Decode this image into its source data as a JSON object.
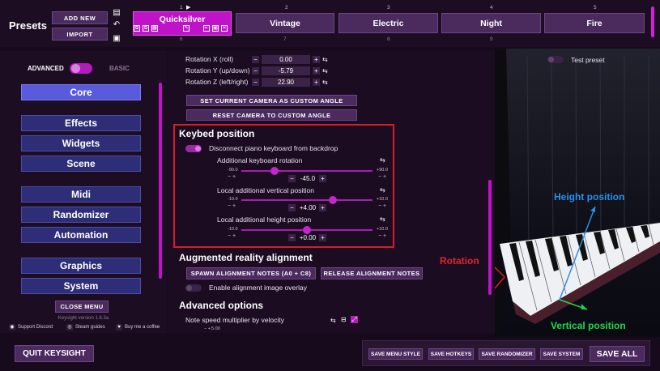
{
  "presets": {
    "label": "Presets",
    "add_new": "ADD NEW",
    "import": "IMPORT",
    "slots_row1": [
      {
        "num": "1",
        "name": "Quicksilver",
        "active": true
      },
      {
        "num": "2",
        "name": "Vintage"
      },
      {
        "num": "3",
        "name": "Electric"
      },
      {
        "num": "4",
        "name": "Night"
      },
      {
        "num": "5",
        "name": "Fire"
      }
    ],
    "slots_row2_nums": [
      "6",
      "7",
      "8",
      "9"
    ]
  },
  "nav": {
    "advanced": "ADVANCED",
    "basic": "BASIC",
    "items": [
      "Core",
      "Effects",
      "Widgets",
      "Scene",
      "Midi",
      "Randomizer",
      "Automation",
      "Graphics",
      "System"
    ],
    "close_menu": "CLOSE MENU",
    "version": "Keysight version 1.6.3a",
    "links": [
      "Support Discord",
      "Steam guides",
      "Buy me a coffee"
    ]
  },
  "panel": {
    "rotation_x": {
      "label": "Rotation X (roll)",
      "value": "0.00"
    },
    "rotation_y": {
      "label": "Rotation Y (up/down)",
      "value": "-5.79"
    },
    "rotation_z": {
      "label": "Rotation Z (left/right)",
      "value": "22.90"
    },
    "set_camera": "SET CURRENT CAMERA AS CUSTOM ANGLE",
    "reset_camera": "RESET CAMERA TO CUSTOM ANGLE",
    "keybed_header": "Keybed position",
    "disconnect_label": "Disconnect piano keyboard from backdrop",
    "sliders": [
      {
        "label": "Additional keyboard rotation",
        "min": "-90.0",
        "max": "+90.0",
        "value": "-45.0",
        "fraction": 0.25
      },
      {
        "label": "Local additional vertical position",
        "min": "-10.0",
        "max": "+10.0",
        "value": "+4.00",
        "fraction": 0.7
      },
      {
        "label": "Local additional height position",
        "min": "-10.0",
        "max": "+10.0",
        "value": "+0.00",
        "fraction": 0.5
      }
    ],
    "ar_header": "Augmented reality alignment",
    "spawn_notes": "SPAWN ALIGNMENT NOTES (A0 + C8)",
    "release_notes": "RELEASE ALIGNMENT NOTES",
    "overlay_label": "Enable alignment image overlay",
    "advanced_header": "Advanced options",
    "note_speed_label": "Note speed multiplier by velocity",
    "note_speed_value": "5.00"
  },
  "viewport": {
    "test_preset": "Test preset",
    "height_position": "Height position",
    "rotation": "Rotation",
    "vertical_position": "Vertical position"
  },
  "bottom": {
    "quit": "QUIT KEYSIGHT",
    "actions": [
      "SAVE MENU STYLE",
      "SAVE HOTKEYS",
      "SAVE RANDOMIZER",
      "SAVE SYSTEM"
    ],
    "save_all": "SAVE ALL"
  },
  "colors": {
    "accent": "#c013c9",
    "nav": "#2e2e78",
    "nav_active": "#5a5add",
    "highlight": "#d51e2a",
    "height_arrow": "#2a8fe8",
    "vertical_arrow": "#1fd84a"
  }
}
